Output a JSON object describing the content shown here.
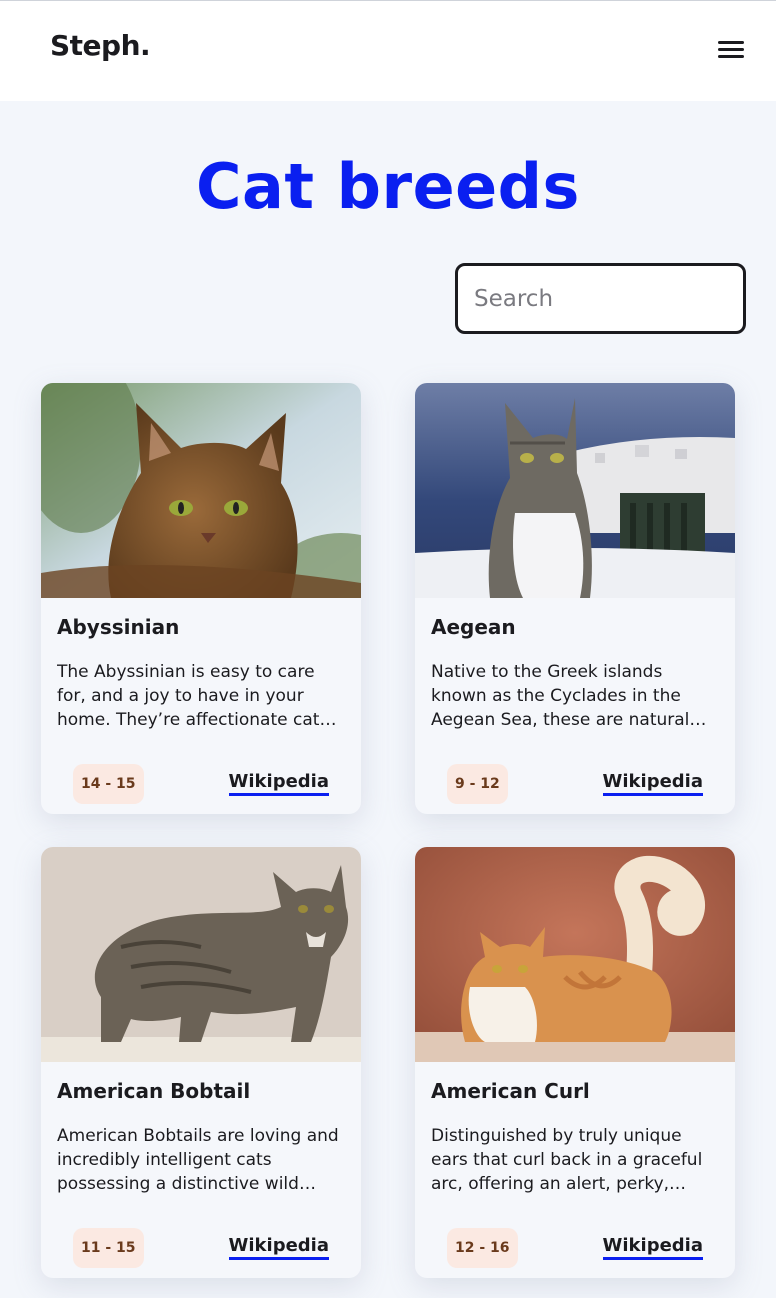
{
  "header": {
    "logo": "Steph.",
    "menu_icon": "hamburger-menu-icon"
  },
  "main": {
    "title": "Cat breeds",
    "search_placeholder": "Search"
  },
  "colors": {
    "accent": "#0a1ff0",
    "background": "#f3f6fb",
    "badge_bg": "#fbe9e2"
  },
  "breeds": [
    {
      "name": "Abyssinian",
      "description": "The Abyssinian is easy to care for, and a joy to have in your home. They’re affectionate cats and love both people and other animals.",
      "life_span": "14 - 15",
      "link": "Wikipedia"
    },
    {
      "name": "Aegean",
      "description": "Native to the Greek islands known as the Cyclades in the Aegean Sea, these are natural cats, meaning they developed without humans getting involved in their breeding.",
      "life_span": "9 - 12",
      "link": "Wikipedia"
    },
    {
      "name": "American Bobtail",
      "description": "American Bobtails are loving and incredibly intelligent cats possessing a distinctive wild appearance.",
      "life_span": "11 - 15",
      "link": "Wikipedia"
    },
    {
      "name": "American Curl",
      "description": "Distinguished by truly unique ears that curl back in a graceful arc, offering an alert, perky, happily surprised expression.",
      "life_span": "12 - 16",
      "link": "Wikipedia"
    }
  ]
}
